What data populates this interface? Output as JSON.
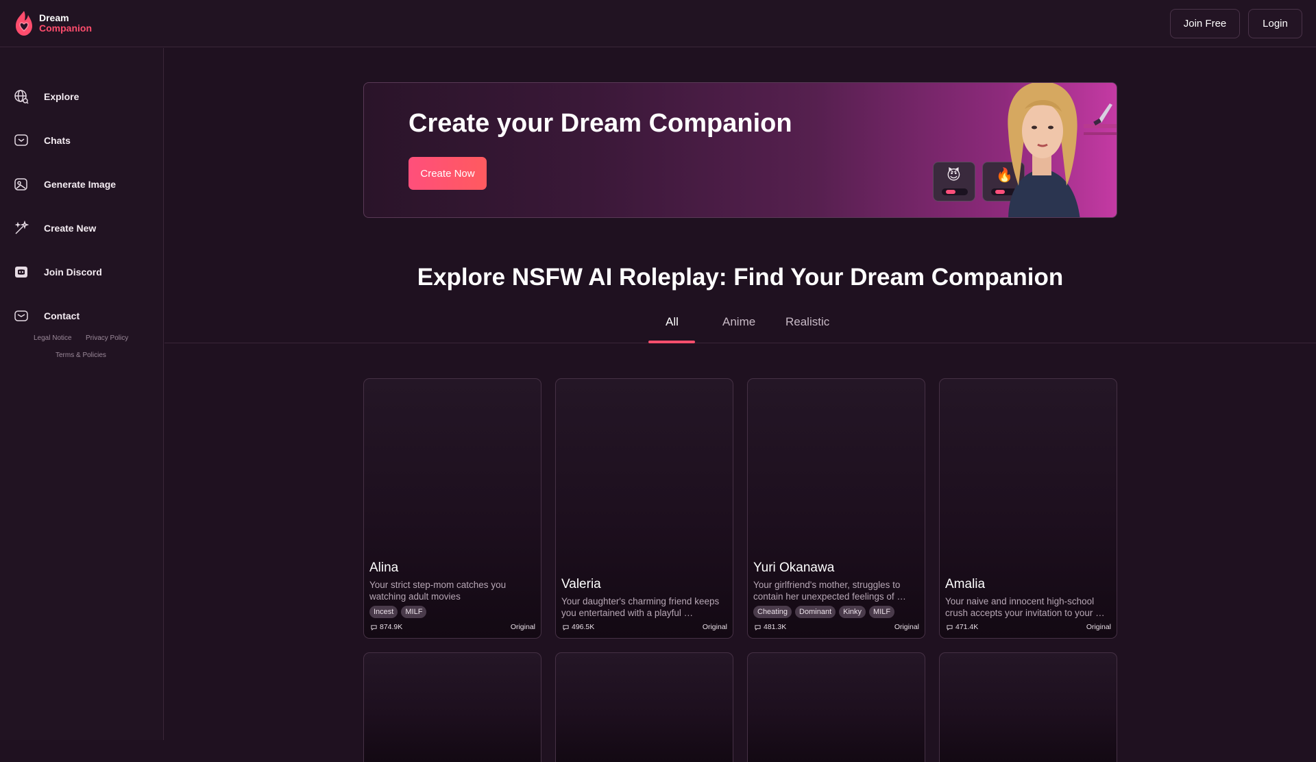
{
  "brand": {
    "line1": "Dream",
    "line2": "Companion",
    "accent": "#ff4d6d"
  },
  "header": {
    "join_label": "Join Free",
    "login_label": "Login"
  },
  "sidebar": {
    "items": [
      {
        "label": "Explore",
        "icon": "globe-icon"
      },
      {
        "label": "Chats",
        "icon": "chat-icon"
      },
      {
        "label": "Generate Image",
        "icon": "image-icon"
      },
      {
        "label": "Create New",
        "icon": "magic-wand-icon"
      },
      {
        "label": "Join Discord",
        "icon": "discord-icon"
      },
      {
        "label": "Contact",
        "icon": "mail-icon"
      }
    ],
    "footer": {
      "legal": "Legal Notice",
      "privacy": "Privacy Policy",
      "terms": "Terms & Policies"
    }
  },
  "banner": {
    "title": "Create your Dream Companion",
    "button": "Create Now",
    "badges": [
      "😈",
      "🔥"
    ]
  },
  "explore": {
    "title": "Explore NSFW AI Roleplay: Find Your Dream Companion",
    "tabs": [
      "All",
      "Anime",
      "Realistic"
    ],
    "active_tab": "All"
  },
  "cards": [
    {
      "name": "Alina",
      "desc": "Your strict step-mom catches you watching adult movies",
      "tags": [
        "Incest",
        "MILF"
      ],
      "count": "874.9K",
      "badge": "Original"
    },
    {
      "name": "Valeria",
      "desc": "Your daughter's charming friend keeps you entertained with a playful …",
      "tags": [],
      "count": "496.5K",
      "badge": "Original"
    },
    {
      "name": "Yuri Okanawa",
      "desc": "Your girlfriend's mother, struggles to contain her unexpected feelings of …",
      "tags": [
        "Cheating",
        "Dominant",
        "Kinky",
        "MILF"
      ],
      "count": "481.3K",
      "badge": "Original"
    },
    {
      "name": "Amalia",
      "desc": "Your naive and innocent high-school crush accepts your invitation to your …",
      "tags": [],
      "count": "471.4K",
      "badge": "Original"
    }
  ]
}
